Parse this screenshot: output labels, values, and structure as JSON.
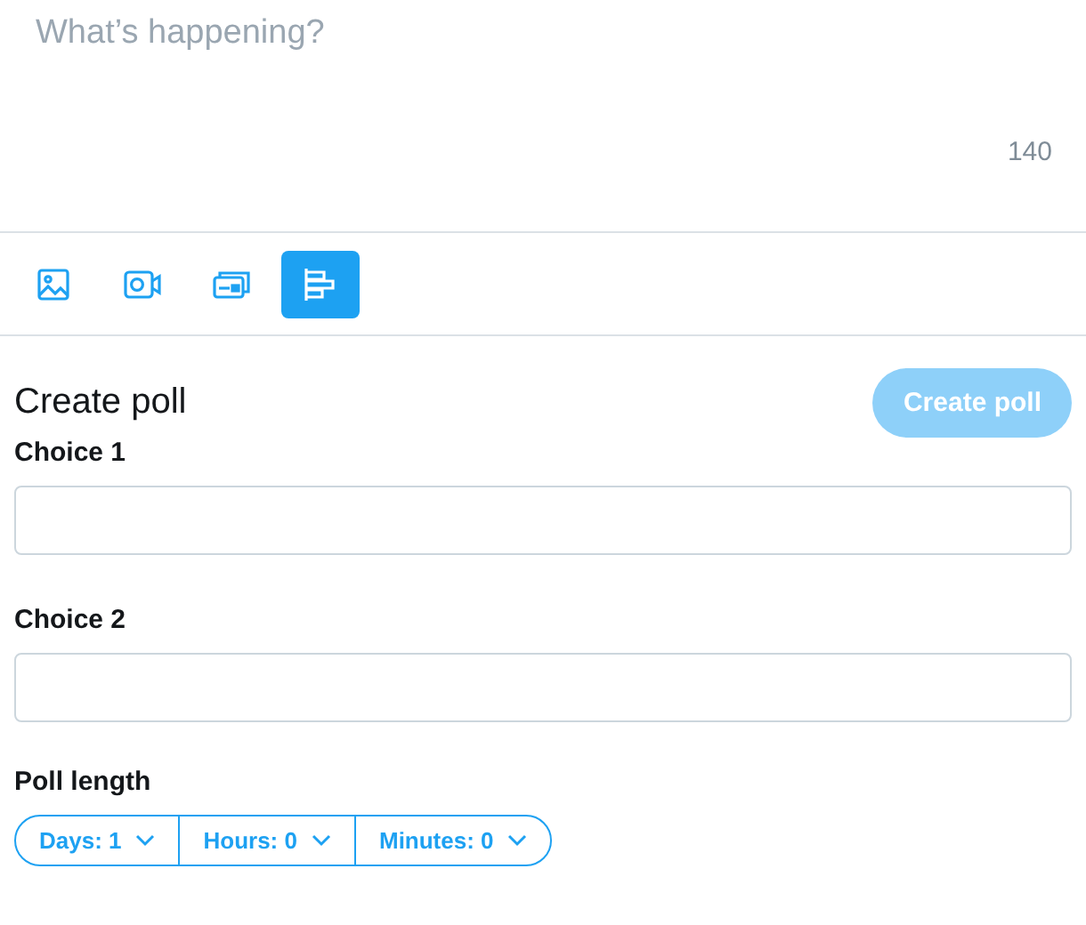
{
  "composer": {
    "placeholder": "What’s happening?",
    "counter": "140"
  },
  "toolbar": [
    {
      "kind": "image",
      "selected": false
    },
    {
      "kind": "video",
      "selected": false
    },
    {
      "kind": "card",
      "selected": false
    },
    {
      "kind": "poll",
      "selected": true
    }
  ],
  "poll": {
    "title": "Create poll",
    "submit": {
      "label": "Create poll",
      "disabled": true
    },
    "choices": [
      {
        "label": "Choice 1"
      },
      {
        "label": "Choice 2"
      }
    ],
    "length_label": "Poll length",
    "length": [
      {
        "label": "Days: 1"
      },
      {
        "label": "Hours: 0"
      },
      {
        "label": "Minutes: 0"
      }
    ]
  }
}
